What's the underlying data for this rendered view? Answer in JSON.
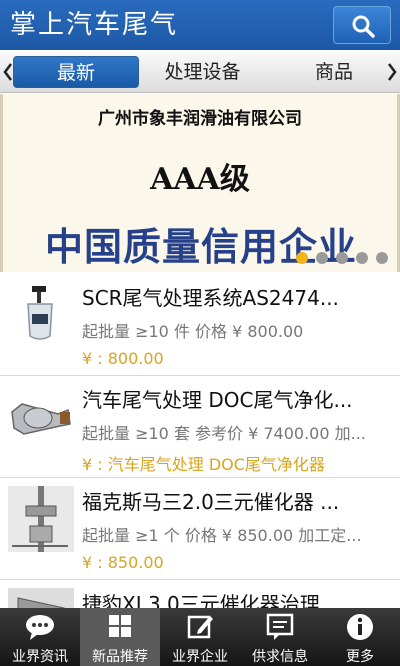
{
  "header": {
    "title": "掌上汽车尾气",
    "search_icon": "search-icon"
  },
  "tabs": [
    {
      "label": "最新",
      "active": true
    },
    {
      "label": "处理设备",
      "active": false
    },
    {
      "label": "商品",
      "active": false
    }
  ],
  "banner": {
    "company": "广州市象丰润滑油有限公司",
    "grade": "AAA级",
    "certification": "中国质量信用企业",
    "slide_count": 5,
    "active_slide": 1
  },
  "products": [
    {
      "title": "SCR尾气处理系统AS2474...",
      "info": "起批量 ≥10 件 价格 ¥ 800.00",
      "price": "¥ : 800.00"
    },
    {
      "title": "汽车尾气处理 DOC尾气净化...",
      "info": "起批量 ≥10 套 参考价 ¥ 7400.00 加...",
      "price": "¥ : 汽车尾气处理 DOC尾气净化器"
    },
    {
      "title": "福克斯马三2.0三元催化器 ...",
      "info": "起批量 ≥1 个 价格 ¥ 850.00 加工定...",
      "price": "¥ : 850.00"
    },
    {
      "title": "捷豹XJ 3.0三元催化器治理...",
      "info": "",
      "price": ""
    }
  ],
  "bottom_nav": [
    {
      "label": "业界资讯",
      "icon": "chat-bubble-icon",
      "active": false
    },
    {
      "label": "新品推荐",
      "icon": "grid-icon",
      "active": true
    },
    {
      "label": "业界企业",
      "icon": "edit-icon",
      "active": false
    },
    {
      "label": "供求信息",
      "icon": "message-icon",
      "active": false
    },
    {
      "label": "更多",
      "icon": "info-icon",
      "active": false
    }
  ],
  "colors": {
    "header_blue": "#1d58a6",
    "price_gold": "#d8a520",
    "cert_blue": "#26418a",
    "dot_active": "#f2b418"
  }
}
